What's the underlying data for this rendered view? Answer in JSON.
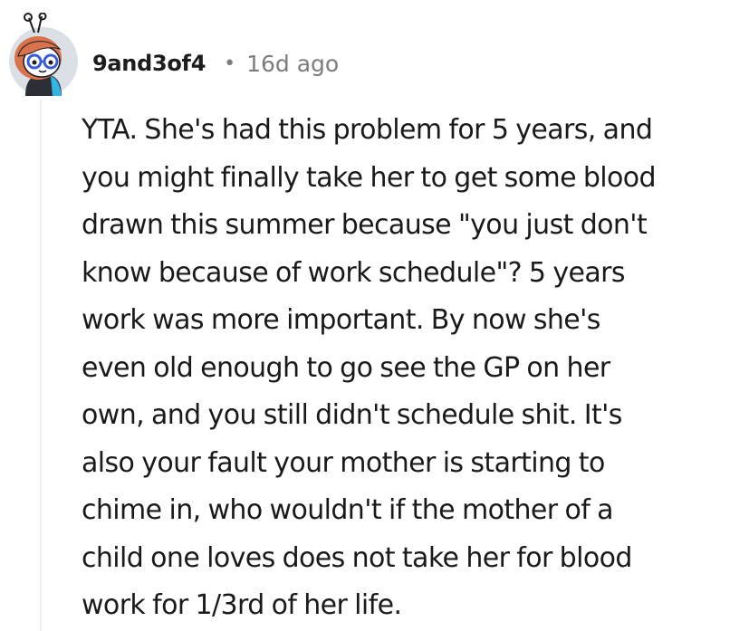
{
  "comment": {
    "username": "9and3of4",
    "separator": "•",
    "age": "16d ago",
    "body_lines": [
      "YTA. She's had this problem for 5 years, and",
      "you might finally take her to get some blood",
      "drawn this summer because \"you just don't",
      "know because of work schedule\"? 5 years",
      "work was more important. By now she's",
      "even old enough to go see the GP on her",
      "own, and you still didn't schedule shit. It's",
      "also your fault your mother is starting to",
      "chime in, who wouldn't if the mother of a",
      "child one loves does not take her for blood",
      "work for 1/3rd of her life."
    ]
  },
  "colors": {
    "text": "#1a1a1b",
    "meta": "#7c7c7c",
    "thread_line": "#edeff1",
    "avatar_bg": "#dae0e6",
    "avatar_hair": "#d9734e",
    "avatar_glasses": "#3b5bdb"
  },
  "icons": {
    "avatar": "snoo-avatar-icon"
  }
}
